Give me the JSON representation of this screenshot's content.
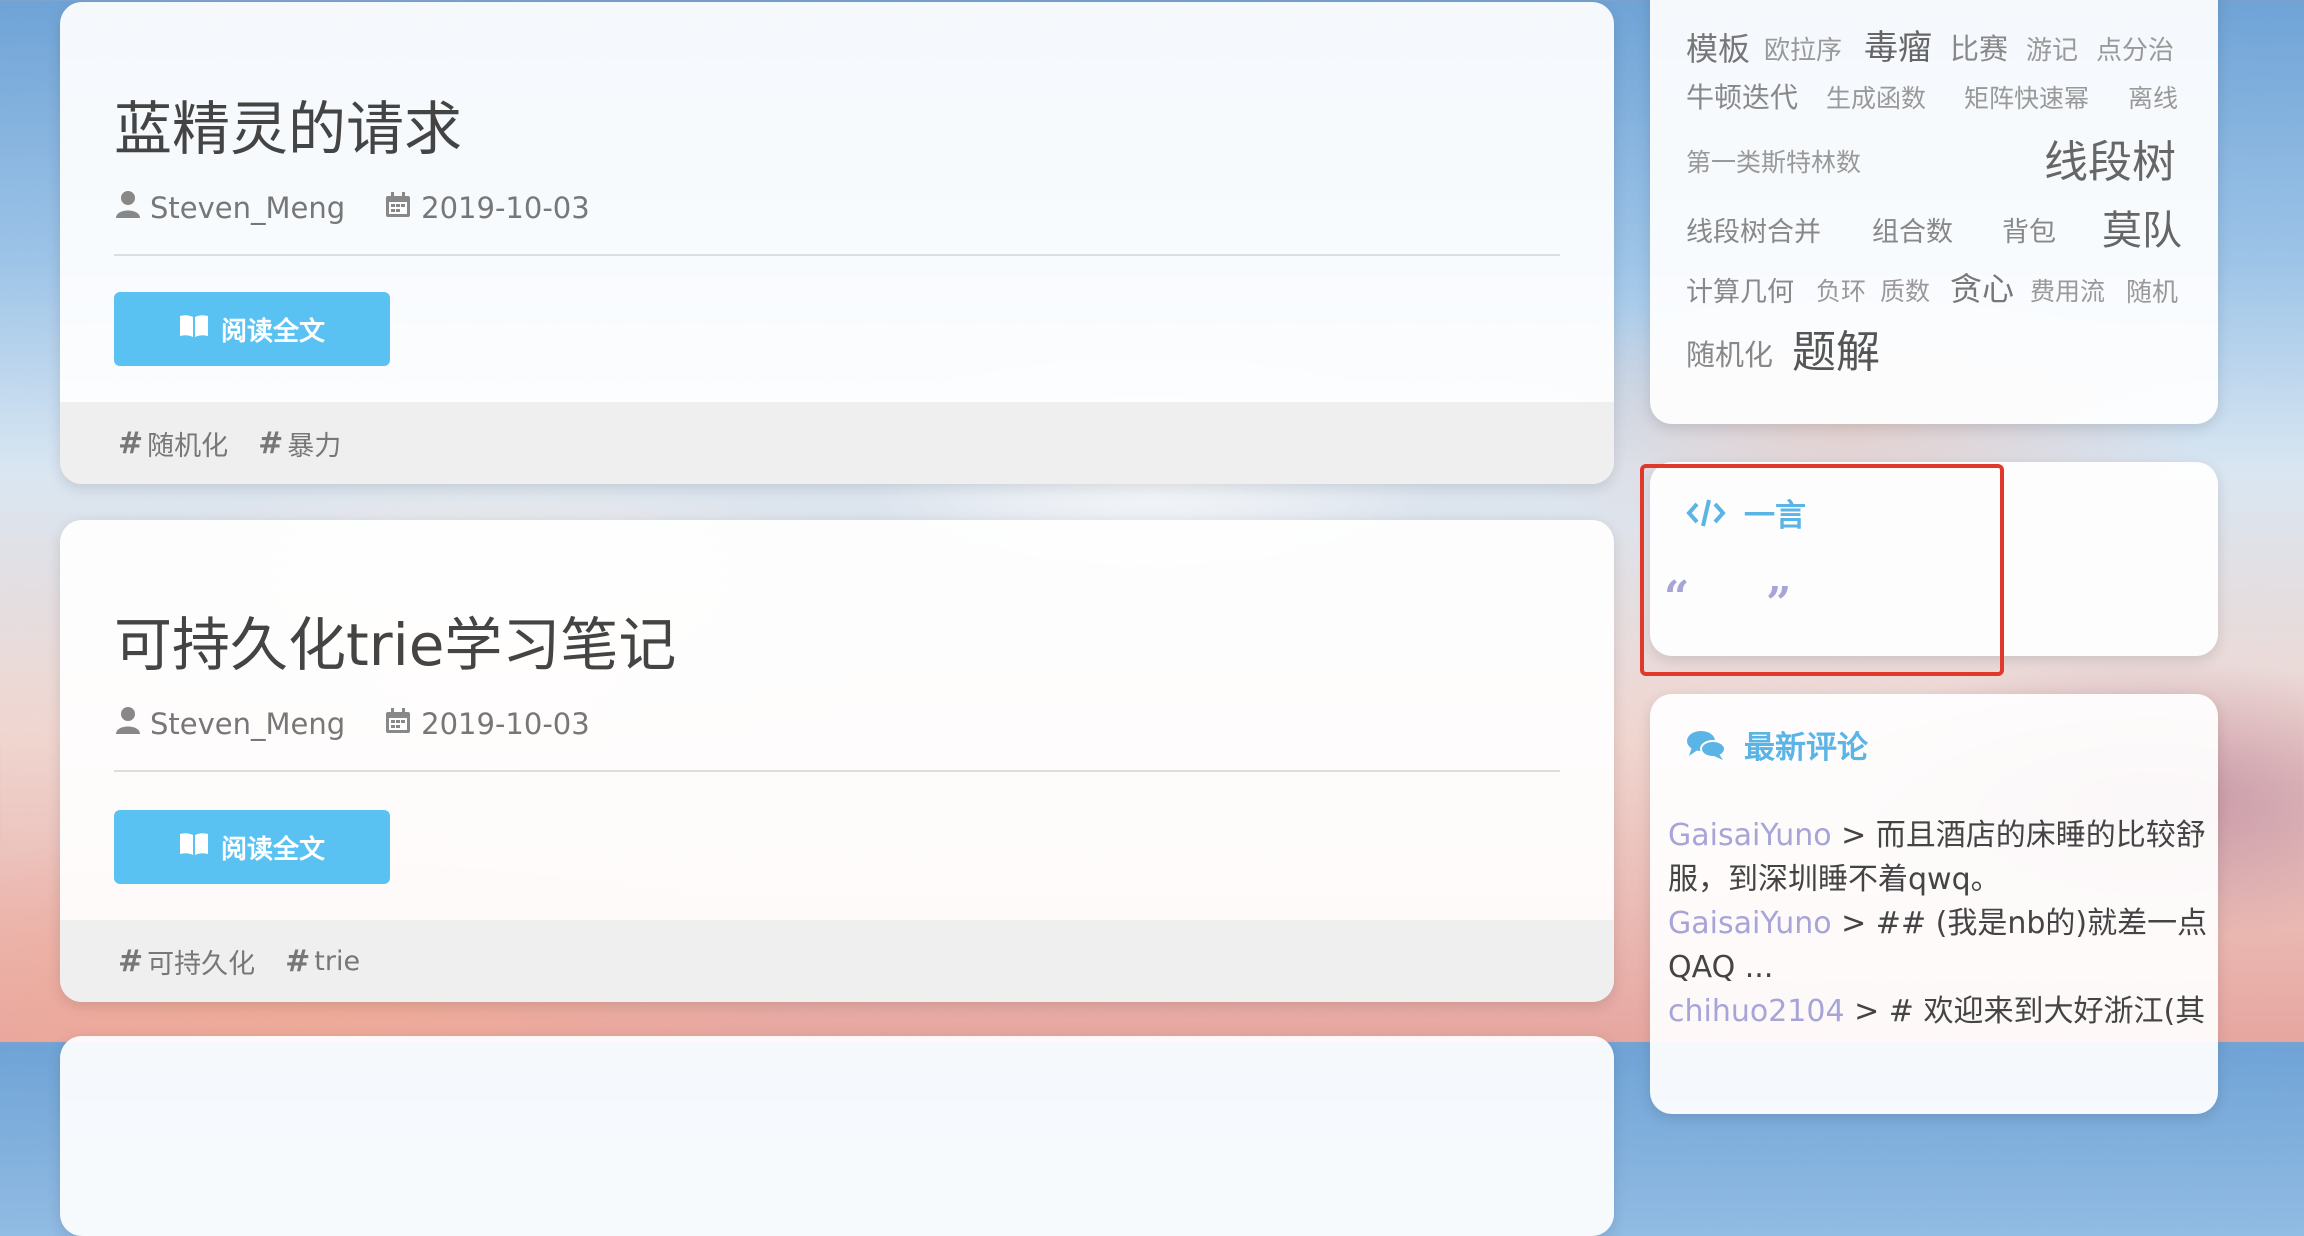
{
  "posts": [
    {
      "title": "蓝精灵的请求",
      "author": "Steven_Meng",
      "date": "2019-10-03",
      "read_label": "阅读全文",
      "tags": [
        "随机化",
        "暴力"
      ]
    },
    {
      "title": "可持久化trie学习笔记",
      "author": "Steven_Meng",
      "date": "2019-10-03",
      "read_label": "阅读全文",
      "tags": [
        "可持久化",
        "trie"
      ]
    }
  ],
  "tag_cloud": {
    "words": [
      "模板",
      "欧拉序",
      "毒瘤",
      "比赛",
      "游记",
      "点分治",
      "牛顿迭代",
      "生成函数",
      "矩阵快速幂",
      "离线",
      "第一类斯特林数",
      "线段树",
      "线段树合并",
      "组合数",
      "背包",
      "莫队",
      "计算几何",
      "负环",
      "质数",
      "贪心",
      "费用流",
      "随机",
      "随机化",
      "题解"
    ]
  },
  "hitokoto": {
    "title": "一言",
    "open_quote": "“",
    "close_quote": "”",
    "icon": "code-icon"
  },
  "recent_comments": {
    "title": "最新评论",
    "icon": "comments-icon",
    "items": [
      {
        "user": "GaisaiYuno",
        "text": " > 而且酒店的床睡的比较舒服，到深圳睡不着qwq。"
      },
      {
        "user": "GaisaiYuno",
        "text": " > ## (我是nb的)就差一点QAQ ..."
      },
      {
        "user": "chihuo2104",
        "text": " > # 欢迎来到大好浙江(其"
      }
    ]
  },
  "colors": {
    "accent": "#5ac2f2",
    "widget_title": "#5ab4e6",
    "username": "#a7a4d8",
    "highlight_border": "#e0392b"
  }
}
